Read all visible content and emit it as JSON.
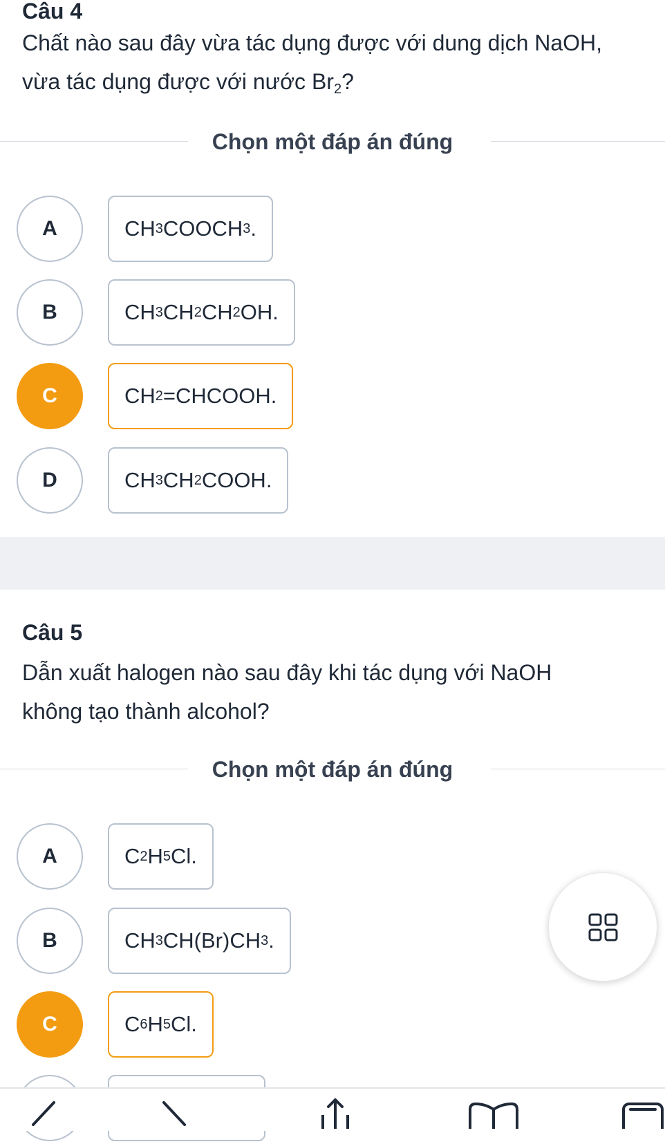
{
  "questions": [
    {
      "title": "Câu 4",
      "text_line1": "Chất nào sau đây vừa tác dụng được với dung dịch NaOH,",
      "text_line2_prefix": "vừa tác dụng được với nước Br",
      "text_line2_sub": "2",
      "text_line2_suffix": "?",
      "instruction": "Chọn một đáp án đúng",
      "selected": "C",
      "options": [
        {
          "letter": "A",
          "parts": [
            "CH",
            "3",
            "COOCH",
            "3",
            "."
          ]
        },
        {
          "letter": "B",
          "parts": [
            "CH",
            "3",
            "CH",
            "2",
            "CH",
            "2",
            "OH."
          ]
        },
        {
          "letter": "C",
          "parts": [
            "CH",
            "2",
            "=CHCOOH."
          ]
        },
        {
          "letter": "D",
          "parts": [
            "CH",
            "3",
            "CH",
            "2",
            "COOH."
          ]
        }
      ]
    },
    {
      "title": "Câu 5",
      "text_line1": "Dẫn xuất halogen nào sau đây khi tác dụng với NaOH",
      "text_line2": "không tạo thành alcohol?",
      "instruction": "Chọn một đáp án đúng",
      "selected": "C",
      "options": [
        {
          "letter": "A",
          "parts": [
            "C",
            "2",
            "H",
            "5",
            "Cl."
          ]
        },
        {
          "letter": "B",
          "parts": [
            "CH",
            "3",
            "CH(Br)CH",
            "3",
            "."
          ]
        },
        {
          "letter": "C",
          "parts": [
            "C",
            "6",
            "H",
            "5",
            "Cl."
          ]
        }
      ]
    }
  ],
  "colors": {
    "selected": "#f39c12",
    "border": "#b8c2cf",
    "text": "#1f2937",
    "gap": "#eef0f3"
  },
  "icons": {
    "fab": "grid-icon",
    "nav": [
      "back-icon",
      "forward-icon",
      "share-icon",
      "bookmarks-icon",
      "tabs-icon"
    ]
  }
}
